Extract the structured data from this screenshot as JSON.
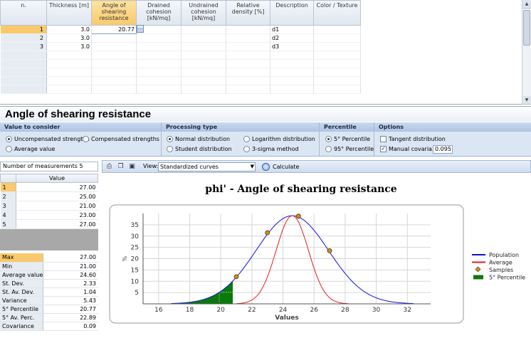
{
  "top_grid": {
    "columns": [
      "n.",
      "Thickness [m]",
      "Angle of shearing resistance",
      "Drained cohesion [kN/mq]",
      "Undrained cohesion [kN/mq]",
      "Relative density [%]",
      "Description",
      "Color / Texture"
    ],
    "rows": [
      {
        "n": "1",
        "thickness": "3.0",
        "angle": "20.77",
        "description": "d1"
      },
      {
        "n": "2",
        "thickness": "3.0",
        "angle": "",
        "description": "d2"
      },
      {
        "n": "3",
        "thickness": "3.0",
        "angle": "",
        "description": "d3"
      }
    ],
    "edit_button": "..."
  },
  "section_title": "Angle of shearing resistance",
  "ribbon": {
    "value_group": {
      "title": "Value to consider",
      "options": [
        "Uncompensated strengths",
        "Compensated strengths",
        "Average value"
      ],
      "selected": "Uncompensated strengths"
    },
    "processing_group": {
      "title": "Processing type",
      "options": [
        "Normal distribution",
        "Logarithm distribution",
        "Student distribution",
        "3-sigma method"
      ],
      "selected": "Normal distribution"
    },
    "percentile_group": {
      "title": "Percentile",
      "options": [
        "5° Percentile",
        "95° Percentile"
      ],
      "selected": "5° Percentile"
    },
    "options_group": {
      "title": "Options",
      "tangent": "Tangent distribution",
      "manual": "Manual covaria...",
      "manual_checked": true,
      "manual_value": "0.095"
    }
  },
  "measurements": {
    "label": "Number of measurements 5",
    "header": "Value",
    "rows": [
      {
        "n": "1",
        "value": "27.00"
      },
      {
        "n": "2",
        "value": "25.00"
      },
      {
        "n": "3",
        "value": "21.00"
      },
      {
        "n": "4",
        "value": "23.00"
      },
      {
        "n": "5",
        "value": "27.00"
      }
    ]
  },
  "stats": [
    {
      "label": "Max",
      "value": "27.00"
    },
    {
      "label": "Min",
      "value": "21.00"
    },
    {
      "label": "Average value",
      "value": "24.60"
    },
    {
      "label": "St. Dev.",
      "value": "2.33"
    },
    {
      "label": "St. Av. Dev.",
      "value": "1.04"
    },
    {
      "label": "Variance",
      "value": "5.43"
    },
    {
      "label": "5° Percentile",
      "value": "20.77"
    },
    {
      "label": "5° Av. Perc.",
      "value": "22.89"
    },
    {
      "label": "Covariance",
      "value": "0.09"
    }
  ],
  "chart_toolbar": {
    "view_label": "View:",
    "view_value": "Standardized curves",
    "calculate_label": "Calculate"
  },
  "chart_data": {
    "type": "line",
    "title": "phi' - Angle of shearing resistance",
    "xlabel": "Values",
    "ylabel": "%",
    "xlim": [
      15,
      33.5
    ],
    "ylim": [
      0,
      40
    ],
    "xticks": [
      16,
      18,
      20,
      22,
      24,
      26,
      28,
      30,
      32
    ],
    "yticks": [
      5,
      10,
      15,
      20,
      25,
      30,
      35
    ],
    "grid": true,
    "legend": "right",
    "series": [
      {
        "name": "Population",
        "color": "#1010e0",
        "mean": 24.6,
        "sd": 2.33,
        "peak": 39,
        "from": 16.8,
        "to": 32.4
      },
      {
        "name": "Average",
        "color": "#e02020",
        "mean": 24.6,
        "sd": 1.04,
        "peak": 39,
        "from": 21.0,
        "to": 28.2
      }
    ],
    "samples": {
      "name": "Samples",
      "color": "#e08a00",
      "points": [
        [
          21,
          12
        ],
        [
          23,
          31.5
        ],
        [
          25,
          38.8
        ],
        [
          27,
          23.5
        ]
      ]
    },
    "percentile": {
      "name": "5° Percentile",
      "color": "#0a7a0a",
      "x": 20.77
    }
  }
}
